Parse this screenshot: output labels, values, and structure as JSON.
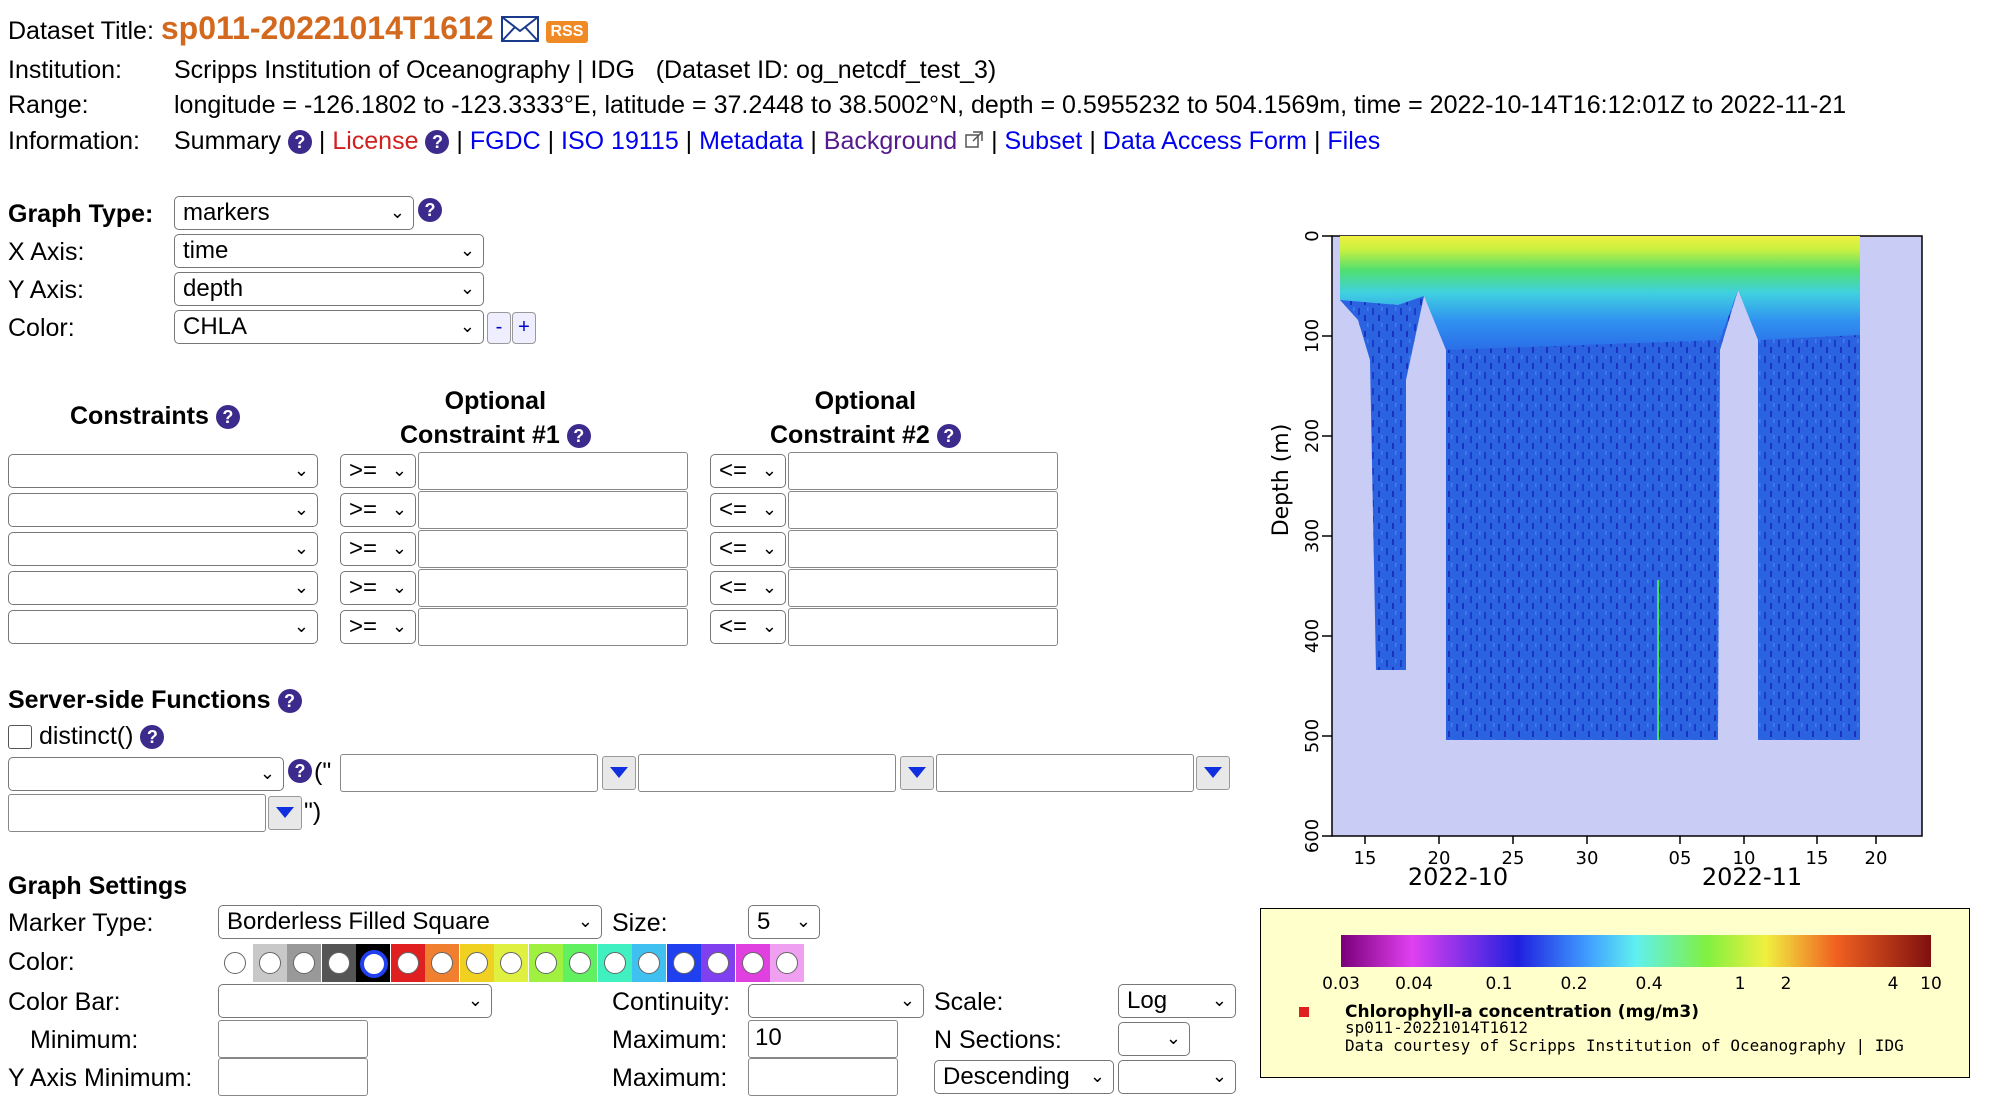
{
  "header": {
    "title_label": "Dataset Title:",
    "title": "sp011-20221014T1612",
    "rss": "RSS",
    "institution_label": "Institution:",
    "institution": "Scripps Institution of Oceanography | IDG",
    "dataset_id": "(Dataset ID: og_netcdf_test_3)",
    "range_label": "Range:",
    "range": "longitude = -126.1802 to -123.3333°E, latitude = 37.2448 to 38.5002°N, depth = 0.5955232 to 504.1569m, time = 2022-10-14T16:12:01Z to 2022-11-21",
    "information_label": "Information:",
    "info_links": {
      "summary": "Summary",
      "license": "License",
      "fgdc": "FGDC",
      "iso": "ISO 19115",
      "metadata": "Metadata",
      "background": "Background",
      "subset": "Subset",
      "daf": "Data Access Form",
      "files": "Files"
    }
  },
  "graph": {
    "type_label": "Graph Type:",
    "type_value": "markers",
    "x_label": "X Axis:",
    "x_value": "time",
    "y_label": "Y Axis:",
    "y_value": "depth",
    "color_label": "Color:",
    "color_value": "CHLA",
    "minus": "-",
    "plus": "+"
  },
  "constraints": {
    "header": "Constraints",
    "opt1_line1": "Optional",
    "opt1_line2": "Constraint #1",
    "opt2_line1": "Optional",
    "opt2_line2": "Constraint #2",
    "op1": ">=",
    "op2": "<="
  },
  "server": {
    "header": "Server-side Functions",
    "distinct": "distinct()",
    "open": "(\"",
    "close": "\")"
  },
  "settings": {
    "header": "Graph Settings",
    "marker_type_label": "Marker Type:",
    "marker_type": "Borderless Filled Square",
    "size_label": "Size:",
    "size": "5",
    "color_label": "Color:",
    "colorbar_label": "Color Bar:",
    "continuity_label": "Continuity:",
    "scale_label": "Scale:",
    "scale": "Log",
    "minimum_label": "Minimum:",
    "maximum_label": "Maximum:",
    "maximum": "10",
    "nsections_label": "N Sections:",
    "ymin_label": "Y Axis Minimum:",
    "ymax_label": "Maximum:",
    "order": "Descending",
    "swatches": [
      "#ffffff",
      "#c8c8c8",
      "#999999",
      "#555555",
      "#000000",
      "#e02020",
      "#f08030",
      "#f0d020",
      "#e0f040",
      "#a0f040",
      "#60f060",
      "#40f0c0",
      "#40c0f0",
      "#2040f0",
      "#8040f0",
      "#e040e0",
      "#f0a0f0"
    ]
  },
  "plot": {
    "ylabel": "Depth (m)",
    "yticks": [
      "0",
      "100",
      "200",
      "300",
      "400",
      "500",
      "600"
    ],
    "xticks": [
      "15",
      "20",
      "25",
      "30",
      "05",
      "10",
      "15",
      "20"
    ],
    "month1": "2022-10",
    "month2": "2022-11",
    "legend_ticks": [
      "0.03",
      "0.04",
      "0.1",
      "0.2",
      "0.4",
      "1",
      "2",
      "4",
      "10"
    ],
    "legend_title": "Chlorophyll-a concentration (mg/m3)",
    "legend_sub": "sp011-20221014T1612",
    "legend_credit": "Data courtesy of Scripps Institution of Oceanography | IDG"
  }
}
